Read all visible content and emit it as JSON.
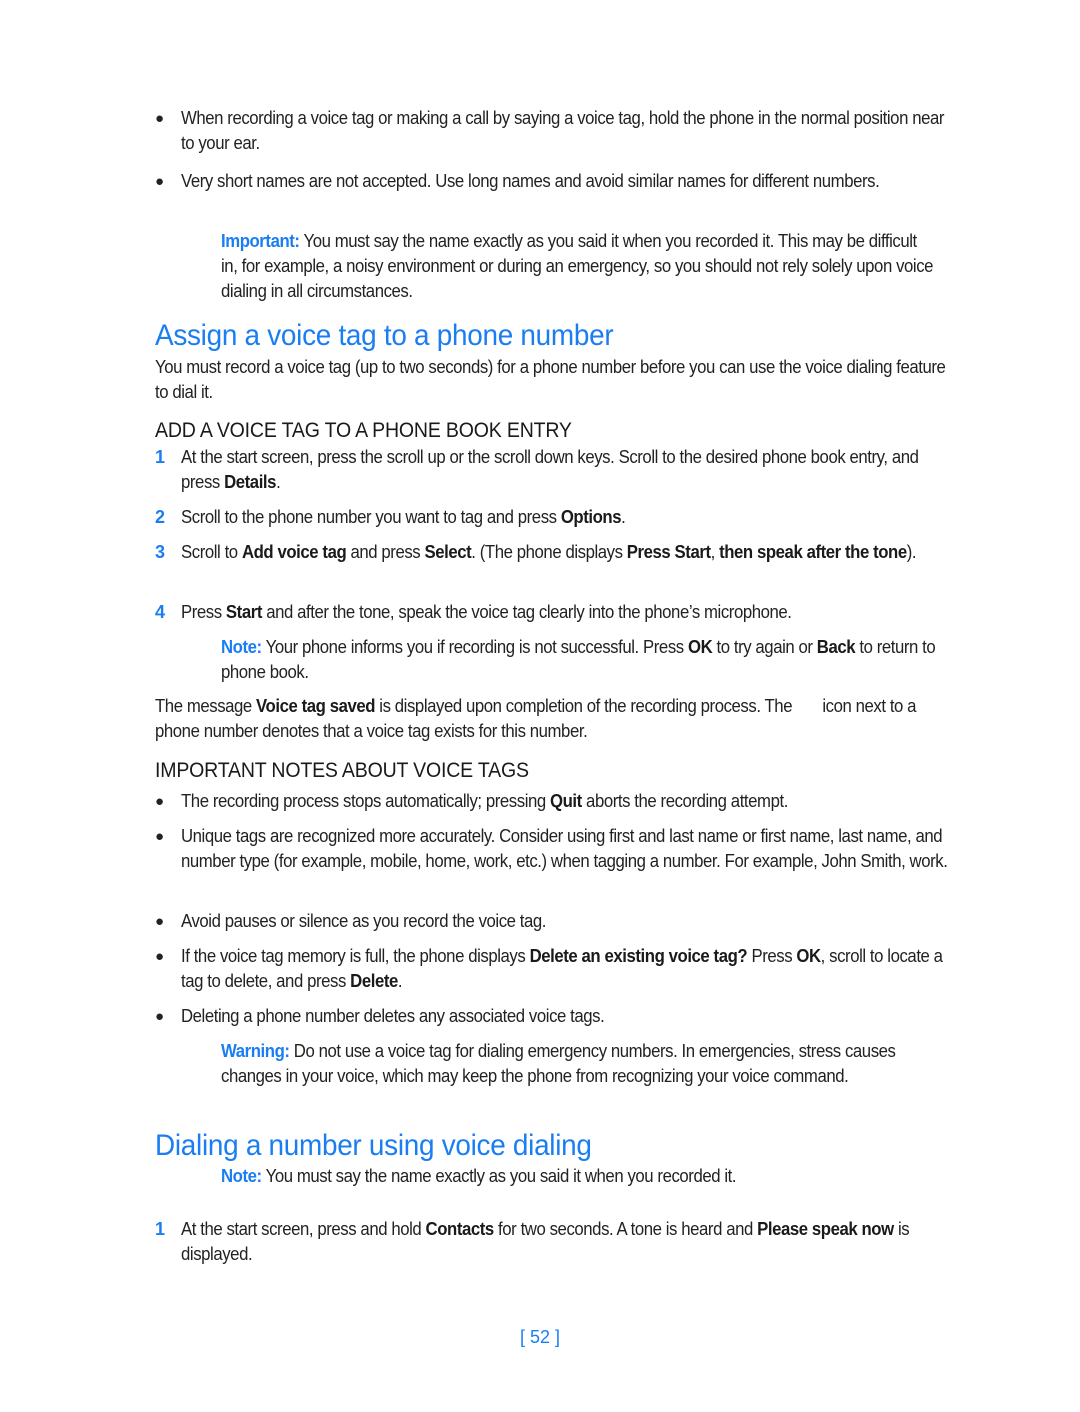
{
  "accent_color": "#1a7ef2",
  "intro_bullets": [
    {
      "text": "When recording a voice tag or making a call by saying a voice tag, hold the phone in the normal position near to your ear."
    },
    {
      "text": "Very short names are not accepted. Use long names and avoid similar names for different numbers."
    }
  ],
  "important_note": {
    "label": "Important:",
    "text": " You must say the name exactly as you said it when you recorded it. This may be difficult in, for example, a noisy environment or during an emergency, so you should not rely solely upon voice dialing in all circumstances."
  },
  "section1": {
    "title": "Assign a voice tag to a phone number",
    "intro": "You must record a voice tag (up to two seconds) for a phone number before you can use the voice dialing feature to dial it.",
    "subsection1": {
      "title": "ADD A VOICE TAG TO A PHONE BOOK ENTRY",
      "steps": [
        {
          "num": "1",
          "parts": [
            "At the start screen, press the scroll up or the scroll down keys. Scroll to the desired phone book entry, and press ",
            "Details",
            "."
          ]
        },
        {
          "num": "2",
          "parts": [
            "Scroll to the phone number you want to tag and press ",
            "Options",
            "."
          ]
        },
        {
          "num": "3",
          "parts": [
            "Scroll to ",
            "Add voice tag",
            " and press ",
            "Select",
            ". (The phone displays ",
            "Press Start",
            ", ",
            "then speak after the tone",
            ")."
          ]
        },
        {
          "num": "4",
          "parts": [
            "Press ",
            "Start",
            " and after the tone, speak the voice tag clearly into the phone’s microphone."
          ]
        }
      ],
      "note": {
        "label": "Note:",
        "parts": [
          " Your phone informs you if recording is not successful. Press ",
          "OK",
          " to try again or ",
          "Back",
          " to return to phone book."
        ]
      },
      "saved_message": {
        "parts": [
          "The message ",
          "Voice tag saved",
          " is displayed upon completion of the recording process. The ",
          "icon next to a phone number denotes that a voice tag exists for this number."
        ]
      }
    },
    "subsection2": {
      "title": "IMPORTANT NOTES ABOUT VOICE TAGS",
      "bullets": [
        {
          "parts": [
            "The recording process stops automatically; pressing ",
            "Quit",
            " aborts the recording attempt."
          ]
        },
        {
          "parts": [
            "Unique tags are recognized more accurately. Consider using first and last name or first name, last name, and number type (for example, mobile, home, work, etc.) when tagging a number. For example, John Smith, work."
          ]
        },
        {
          "parts": [
            "Avoid pauses or silence as you record the voice tag."
          ]
        },
        {
          "parts": [
            "If the voice tag memory is full, the phone displays ",
            "Delete an existing voice tag?",
            " Press ",
            "OK",
            ", scroll to locate a tag to delete, and press ",
            "Delete",
            "."
          ]
        },
        {
          "parts": [
            "Deleting a phone number deletes any associated voice tags."
          ]
        }
      ],
      "warning": {
        "label": "Warning:",
        "text": " Do not use a voice tag for dialing emergency numbers. In emergencies, stress causes changes in your voice, which may keep the phone from recognizing your voice command."
      }
    }
  },
  "section2": {
    "title": "Dialing a number using voice dialing",
    "note": {
      "label": "Note:",
      "text": " You must say the name exactly as you said it when you recorded it."
    },
    "steps": [
      {
        "num": "1",
        "parts": [
          "At the start screen, press and hold ",
          "Contacts",
          " for two seconds. A tone is heard and ",
          "Please speak now",
          " is displayed."
        ]
      }
    ]
  },
  "footer": {
    "page_number": "[ 52 ]"
  }
}
